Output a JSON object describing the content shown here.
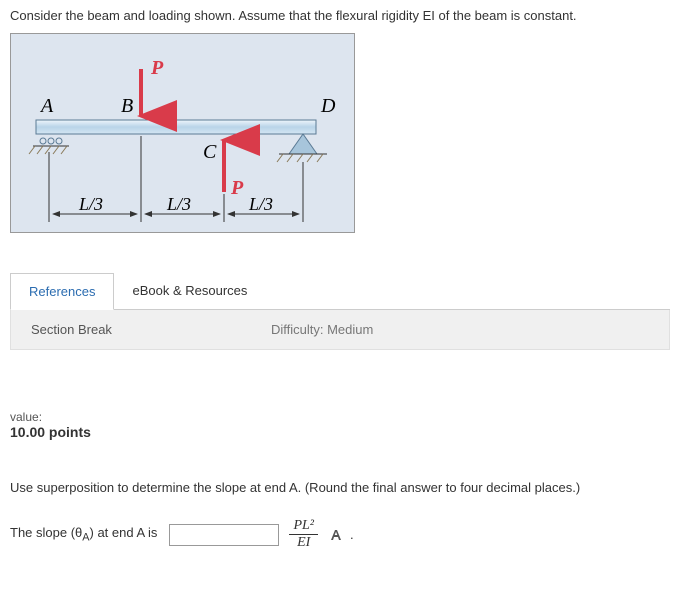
{
  "problem": {
    "statement": "Consider the beam and loading shown. Assume that the flexural rigidity EI of the beam is constant."
  },
  "diagram": {
    "pointA": "A",
    "pointB": "B",
    "pointC": "C",
    "pointD": "D",
    "loadP_top": "P",
    "loadP_bottom": "P",
    "dim1": "L/3",
    "dim2": "L/3",
    "dim3": "L/3"
  },
  "tabs": {
    "references": "References",
    "ebook": "eBook & Resources"
  },
  "section": {
    "label": "Section Break",
    "difficulty": "Difficulty: Medium"
  },
  "value": {
    "label": "value:",
    "points": "10.00 points"
  },
  "question": {
    "text": "Use superposition to determine the slope at end A. (Round the final answer to four decimal places.)",
    "prompt_before": "The slope (θ",
    "prompt_sub": "A",
    "prompt_after": ") at end A is",
    "unit_numerator": "PL²",
    "unit_denominator": "EI",
    "period": "."
  },
  "answer_value": ""
}
